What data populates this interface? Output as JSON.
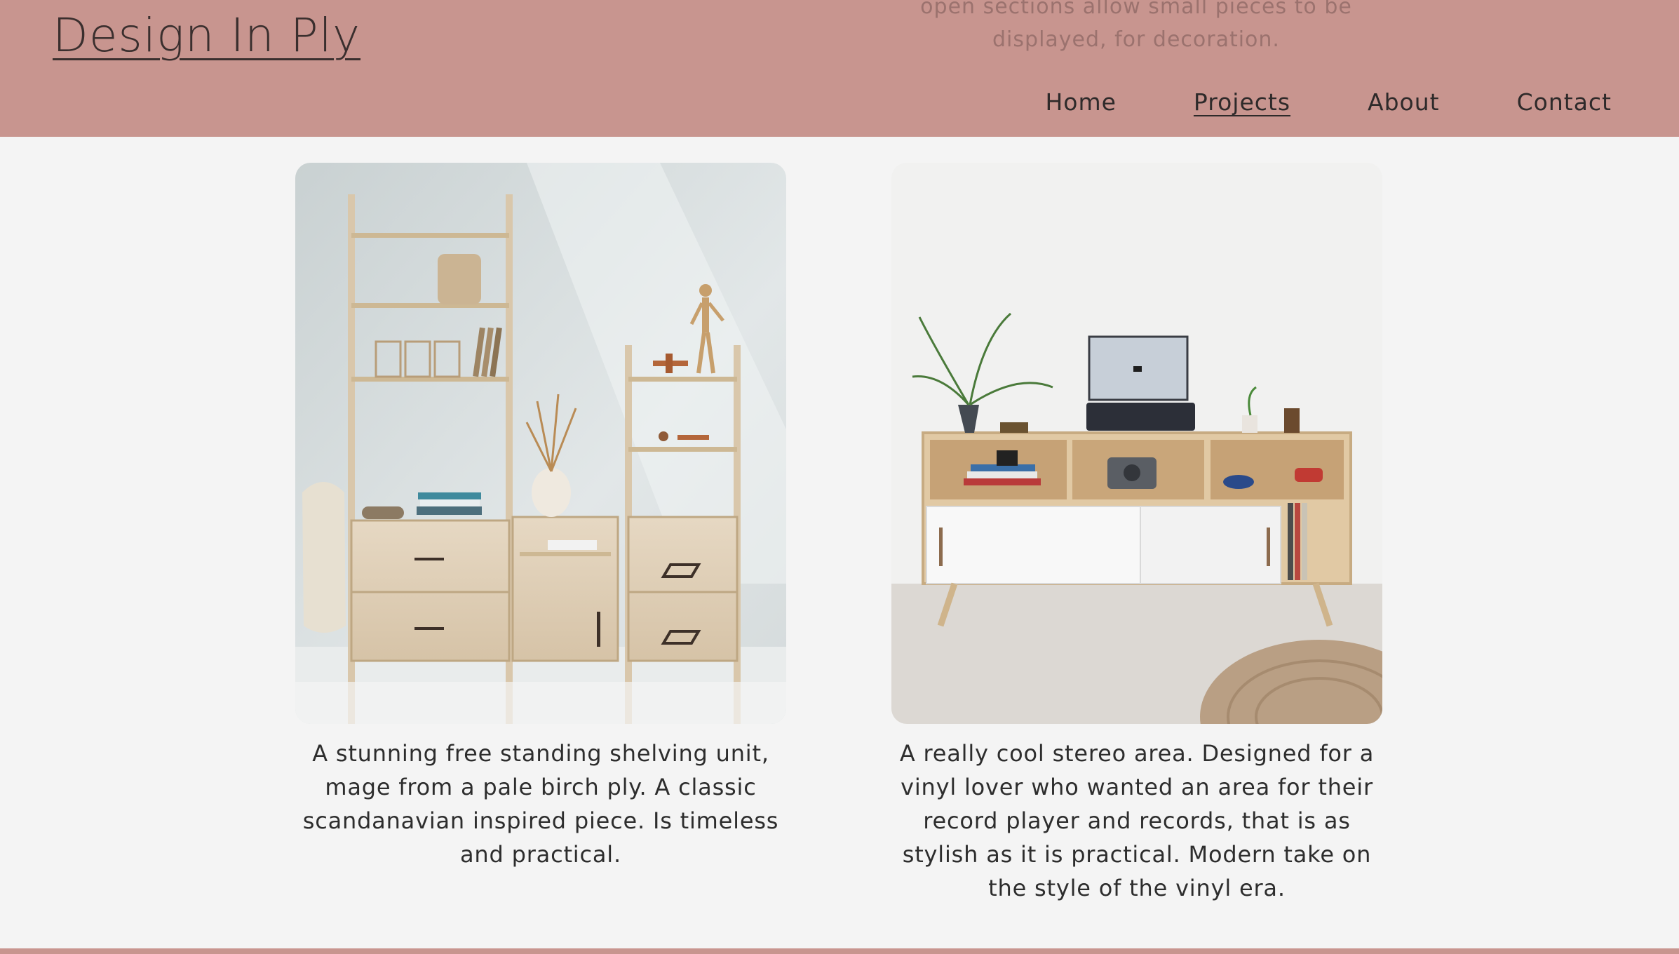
{
  "site": {
    "logo": "Design In Ply",
    "scrolled_text": "open sections allow small pieces to be displayed, for decoration."
  },
  "nav": {
    "items": [
      {
        "label": "Home",
        "active": false
      },
      {
        "label": "Projects",
        "active": true
      },
      {
        "label": "About",
        "active": false
      },
      {
        "label": "Contact",
        "active": false
      }
    ]
  },
  "projects": [
    {
      "image": "birch-ply-shelving-unit-photo",
      "caption": "A stunning free standing shelving unit, mage from a pale birch ply. A classic scandanavian inspired piece. Is timeless and practical."
    },
    {
      "image": "stereo-sideboard-photo",
      "caption": "A really cool stereo area. Designed for a vinyl lover who wanted an area for their record player and records, that is as stylish as it is practical. Modern take on the style of the vinyl era."
    }
  ],
  "colors": {
    "header": "#c8958f",
    "background": "#f4f4f4",
    "text": "#2b2b2b"
  }
}
